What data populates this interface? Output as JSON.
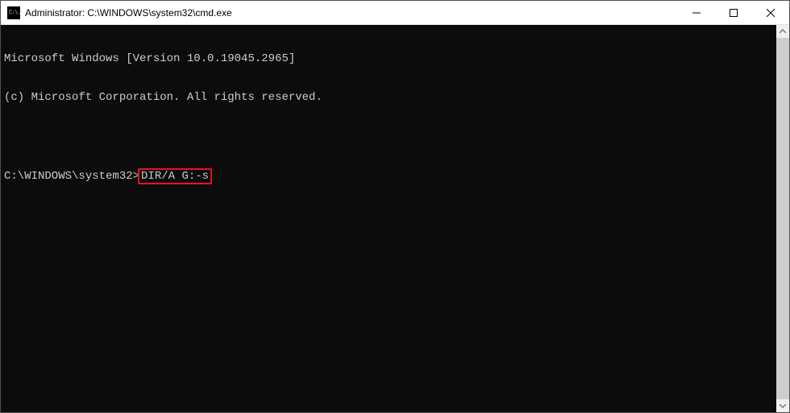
{
  "window": {
    "icon_text": "C:\\.",
    "title": "Administrator: C:\\WINDOWS\\system32\\cmd.exe"
  },
  "terminal": {
    "line1": "Microsoft Windows [Version 10.0.19045.2965]",
    "line2": "(c) Microsoft Corporation. All rights reserved.",
    "line3_blank": "",
    "prompt": "C:\\WINDOWS\\system32>",
    "command": "DIR/A G:-s"
  }
}
